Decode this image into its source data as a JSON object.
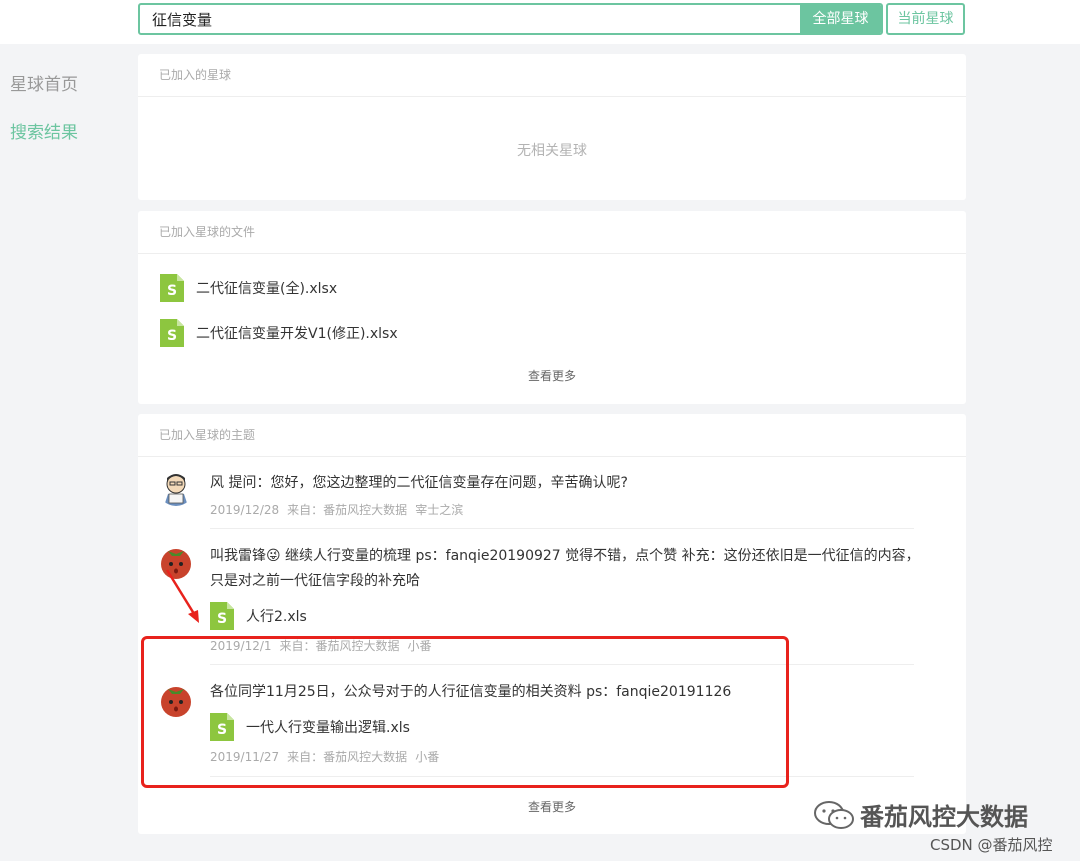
{
  "search": {
    "value": "征信变量",
    "btn_all": "全部星球",
    "btn_current": "当前星球"
  },
  "sidebar": {
    "items": [
      {
        "label": "星球首页"
      },
      {
        "label": "搜索结果"
      }
    ]
  },
  "joined_planets": {
    "header": "已加入的星球",
    "empty_text": "无相关星球"
  },
  "files": {
    "header": "已加入星球的文件",
    "items": [
      {
        "name": "二代征信变量(全).xlsx"
      },
      {
        "name": "二代征信变量开发V1(修正).xlsx"
      }
    ],
    "more": "查看更多"
  },
  "topics": {
    "header": "已加入星球的主题",
    "items": [
      {
        "text": "风 提问：您好，您这边整理的二代征信变量存在问题，辛苦确认呢?",
        "date": "2019/12/28",
        "source": "来自：番茄风控大数据",
        "author": "宰士之滨"
      },
      {
        "text": "叫我雷锋😜 继续人行变量的梳理 ps：fanqie20190927 觉得不错，点个赞  补充：这份还依旧是一代征信的内容，只是对之前一代征信字段的补充哈",
        "file": "人行2.xls",
        "date": "2019/12/1",
        "source": "来自：番茄风控大数据",
        "author": "小番"
      },
      {
        "text": "各位同学11月25日，公众号对于的人行征信变量的相关资料 ps：fanqie20191126",
        "file": "一代人行变量输出逻辑.xls",
        "date": "2019/11/27",
        "source": "来自：番茄风控大数据",
        "author": "小番"
      }
    ],
    "more": "查看更多"
  },
  "watermark": {
    "text": "番茄风控大数据",
    "credit": "CSDN @番茄风控"
  },
  "colors": {
    "accent": "#6cc5a0",
    "highlight": "#e8221c",
    "file_icon": "#8dc63f"
  }
}
